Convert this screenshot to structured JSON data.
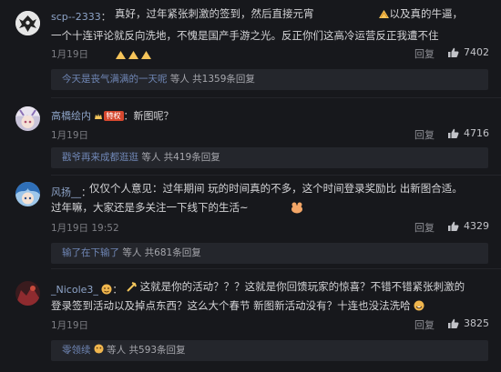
{
  "comments": [
    {
      "username": "scp--2333",
      "text_1": "真好，过年紧张刺激的签到，然后直接元宵",
      "text_2": "以及真的牛逼，一个十连评论就反向洗地，不愧是国产手游之光。反正你们这高冷运营反正我遭不住",
      "date": "1月19日",
      "reply_label": "回复",
      "likes": "7402",
      "sub_user": "今天是丧气满满的一天呢",
      "sub_rest": " 等人 共1359条回复"
    },
    {
      "username": "高橋绘内",
      "badge": "特权",
      "text_1": "新图呢？",
      "date": "1月19日",
      "reply_label": "回复",
      "likes": "4716",
      "sub_user": "戳爷再来成都逛逛",
      "sub_rest": " 等人 共419条回复"
    },
    {
      "username": "风扬__",
      "text_1": "仅仅个人意见：过年期间 玩的时间真的不多，这个时间登录奖励比 出新图合适。过年嘛，大家还是多关注一下线下的生活~",
      "date": "1月19日 19:52",
      "reply_label": "回复",
      "likes": "4329",
      "sub_user": "输了在下输了",
      "sub_rest": " 等人 共681条回复"
    },
    {
      "username": "_Nicole3_",
      "text_1": "这就是你的活动？？？这就是你回馈玩家的惊喜？不错不错紧张刺激的登录签到活动以及掉点东西？这么大个春节 新图新活动没有？十连也没法洗哈",
      "date": "1月19日",
      "reply_label": "回复",
      "likes": "3825",
      "sub_user": "零领续",
      "sub_rest": " 等人 共593条回复"
    }
  ],
  "colors": {
    "background": "#17181c",
    "username": "#8ea4c8",
    "reply_user": "#6f86b5",
    "badge": "#d6482f"
  },
  "icons": [
    "thumbs-up-icon",
    "emoji-icon",
    "crown-icon"
  ]
}
